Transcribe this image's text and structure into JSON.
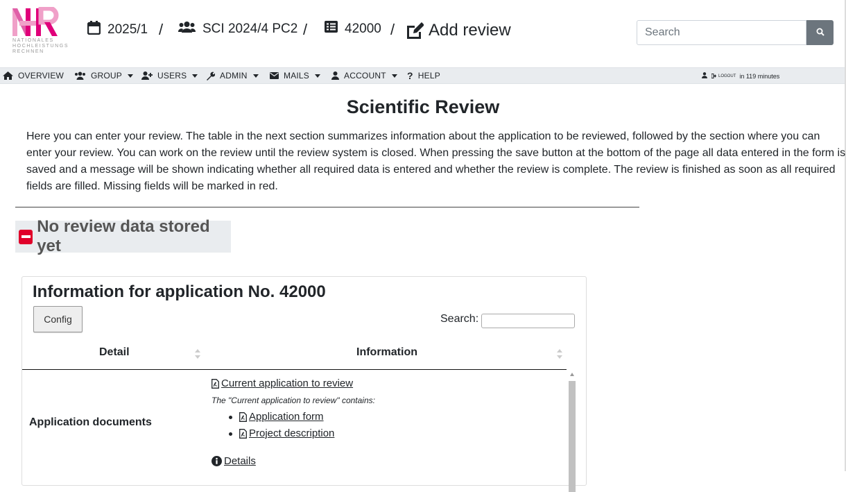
{
  "logo": {
    "text": "NATIONALES HOCHLEISTUNGS RECHNEN"
  },
  "breadcrumb": {
    "period": "2025/1",
    "group": "SCI 2024/4 PC2",
    "application": "42000",
    "current": "Add review",
    "separator": "/"
  },
  "search": {
    "placeholder": "Search"
  },
  "nav": {
    "items": [
      {
        "label": "OVERVIEW"
      },
      {
        "label": "GROUP"
      },
      {
        "label": "USERS"
      },
      {
        "label": "ADMIN"
      },
      {
        "label": "MAILS"
      },
      {
        "label": "ACCOUNT"
      },
      {
        "label": "HELP"
      }
    ],
    "logout": "LOGOUT",
    "session": "in 119 minutes"
  },
  "page": {
    "title": "Scientific Review",
    "intro": "Here you can enter your review. The table in the next section summarizes information about the application to be reviewed, followed by the section where you can enter your review. You can work on the review until the review system is closed. When pressing the save button at the bottom of the page all data entered in the form is saved and a message will be shown indicating whether all required data is entered and whether the review is complete. The review is finished as soon as all required fields are filled. Missing fields will be marked in red.",
    "status": "No review data stored yet",
    "status_color": "#e0002a"
  },
  "info": {
    "title": "Information for application No. 42000",
    "config_label": "Config",
    "search_label": "Search:",
    "columns": [
      "Detail",
      "Information"
    ],
    "row_label": "Application documents",
    "current_link": "Current application to review",
    "contains_note": "The \"Current application to review\" contains:",
    "documents": [
      "Application form",
      "Project description"
    ],
    "details_link": "Details"
  }
}
